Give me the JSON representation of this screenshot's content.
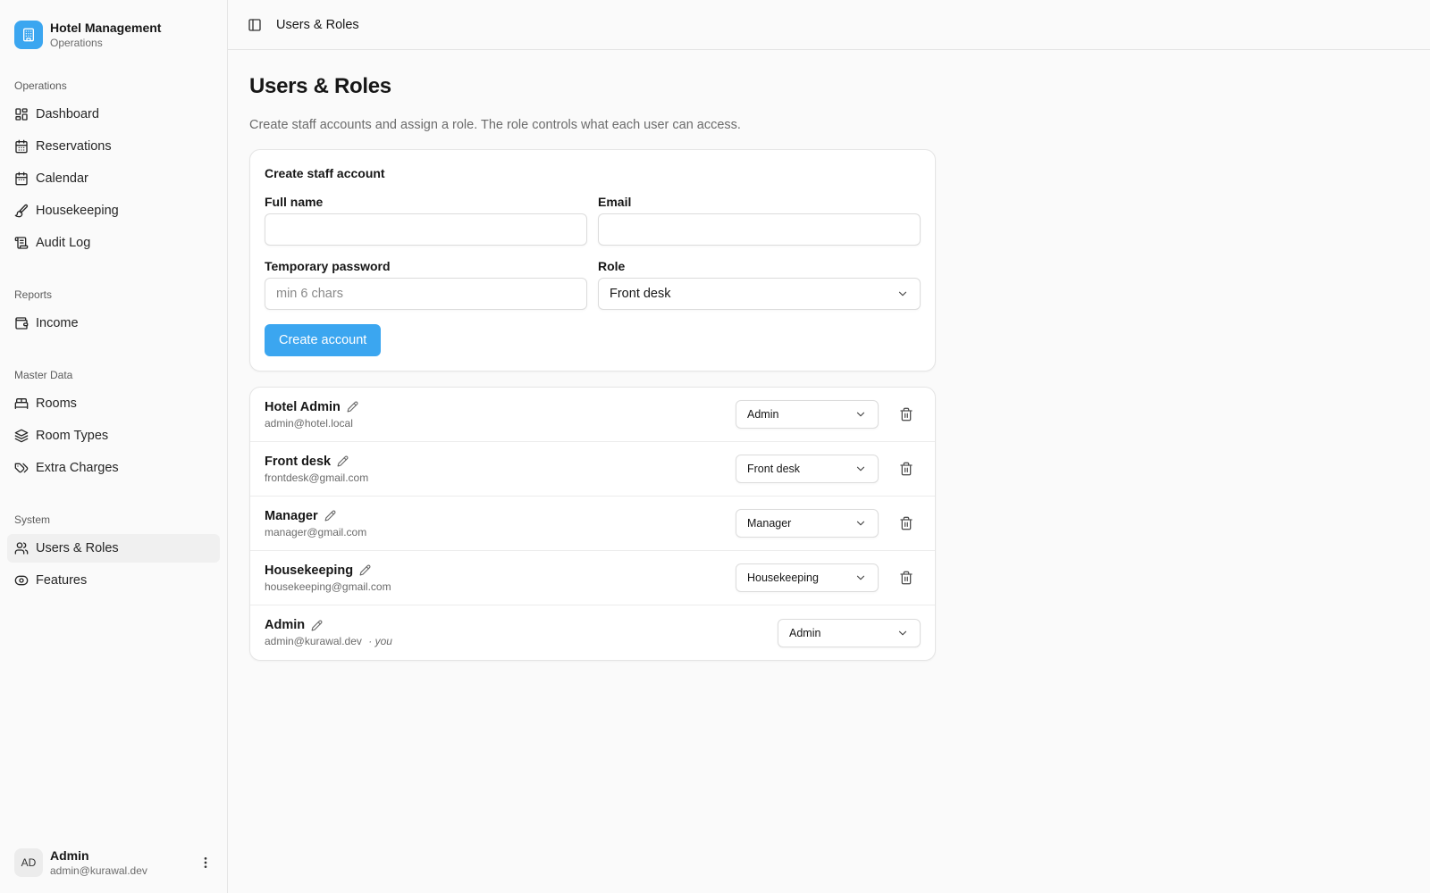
{
  "brand": {
    "title": "Hotel Management",
    "subtitle": "Operations"
  },
  "sidebar": {
    "groups": [
      {
        "label": "Operations",
        "items": [
          {
            "label": "Dashboard",
            "icon": "dashboard-icon"
          },
          {
            "label": "Reservations",
            "icon": "calendar-check-icon"
          },
          {
            "label": "Calendar",
            "icon": "calendar-icon"
          },
          {
            "label": "Housekeeping",
            "icon": "brush-icon"
          },
          {
            "label": "Audit Log",
            "icon": "scroll-icon"
          }
        ]
      },
      {
        "label": "Reports",
        "items": [
          {
            "label": "Income",
            "icon": "wallet-icon"
          }
        ]
      },
      {
        "label": "Master Data",
        "items": [
          {
            "label": "Rooms",
            "icon": "bed-icon"
          },
          {
            "label": "Room Types",
            "icon": "layers-icon"
          },
          {
            "label": "Extra Charges",
            "icon": "tags-icon"
          }
        ]
      },
      {
        "label": "System",
        "items": [
          {
            "label": "Users & Roles",
            "icon": "users-icon",
            "active": true
          },
          {
            "label": "Features",
            "icon": "eye-icon"
          }
        ]
      }
    ]
  },
  "user": {
    "initials": "AD",
    "name": "Admin",
    "email": "admin@kurawal.dev"
  },
  "topbar": {
    "title": "Users & Roles"
  },
  "page": {
    "title": "Users & Roles",
    "description": "Create staff accounts and assign a role. The role controls what each user can access."
  },
  "form": {
    "title": "Create staff account",
    "full_name_label": "Full name",
    "full_name_value": "",
    "email_label": "Email",
    "email_value": "",
    "password_label": "Temporary password",
    "password_placeholder": "min 6 chars",
    "role_label": "Role",
    "role_value": "Front desk",
    "submit_label": "Create account"
  },
  "users": [
    {
      "name": "Hotel Admin",
      "email": "admin@hotel.local",
      "role": "Admin",
      "you": false
    },
    {
      "name": "Front desk",
      "email": "frontdesk@gmail.com",
      "role": "Front desk",
      "you": false
    },
    {
      "name": "Manager",
      "email": "manager@gmail.com",
      "role": "Manager",
      "you": false
    },
    {
      "name": "Housekeeping",
      "email": "housekeeping@gmail.com",
      "role": "Housekeeping",
      "you": false
    },
    {
      "name": "Admin",
      "email": "admin@kurawal.dev",
      "role": "Admin",
      "you": true,
      "you_label": "· you"
    }
  ],
  "colors": {
    "accent": "#3ba6f0",
    "active_bg": "#f0f0f0"
  }
}
